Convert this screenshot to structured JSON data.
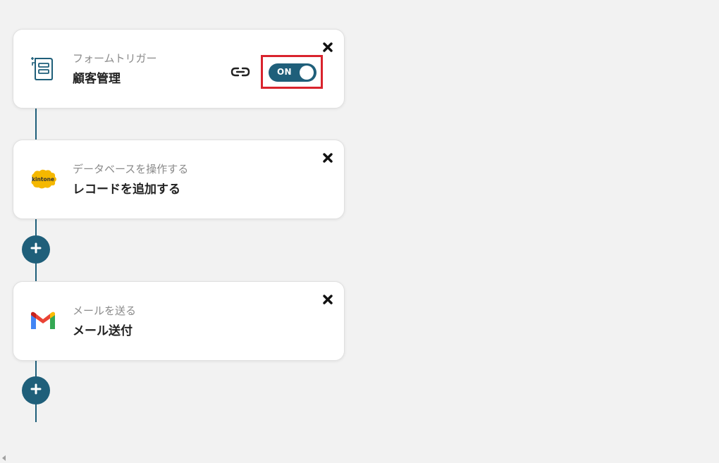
{
  "flow": {
    "steps": [
      {
        "subtitle": "フォームトリガー",
        "title": "顧客管理",
        "icon": "form-icon",
        "toggle_label": "ON",
        "has_link": true
      },
      {
        "subtitle": "データベースを操作する",
        "title": "レコードを追加する",
        "icon": "kintone-icon",
        "icon_text": "kintone"
      },
      {
        "subtitle": "メールを送る",
        "title": "メール送付",
        "icon": "gmail-icon"
      }
    ]
  },
  "colors": {
    "accent": "#1f5f7a",
    "highlight": "#d9232d",
    "kintone": "#f5b800",
    "background": "#f2f2f2"
  }
}
